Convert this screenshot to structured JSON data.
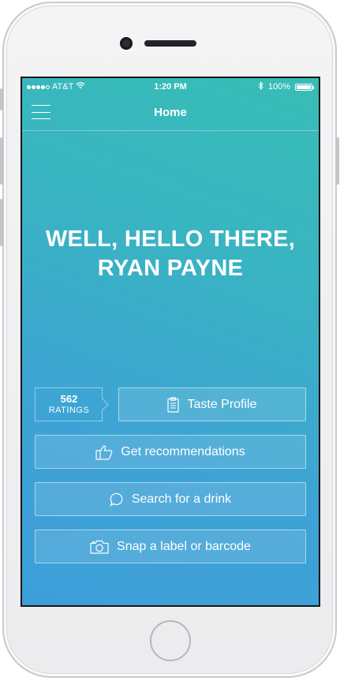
{
  "status_bar": {
    "carrier": "AT&T",
    "time": "1:20 PM",
    "battery": "100%"
  },
  "nav": {
    "title": "Home"
  },
  "greeting": {
    "line1": "WELL, HELLO THERE,",
    "line2": "RYAN PAYNE"
  },
  "ratings": {
    "count": "562",
    "label": "RATINGS"
  },
  "buttons": {
    "taste_profile": "Taste Profile",
    "recommendations": "Get recommendations",
    "search": "Search for a drink",
    "snap": "Snap a label or barcode"
  },
  "icons": {
    "menu": "hamburger-menu-icon",
    "taste_profile": "clipboard-icon",
    "recommendations": "thumbs-up-icon",
    "search": "speech-bubble-icon",
    "snap": "camera-icon"
  },
  "colors": {
    "gradient_top": "#38bdb6",
    "gradient_bottom": "#3d9fd8",
    "text": "#ffffff"
  }
}
